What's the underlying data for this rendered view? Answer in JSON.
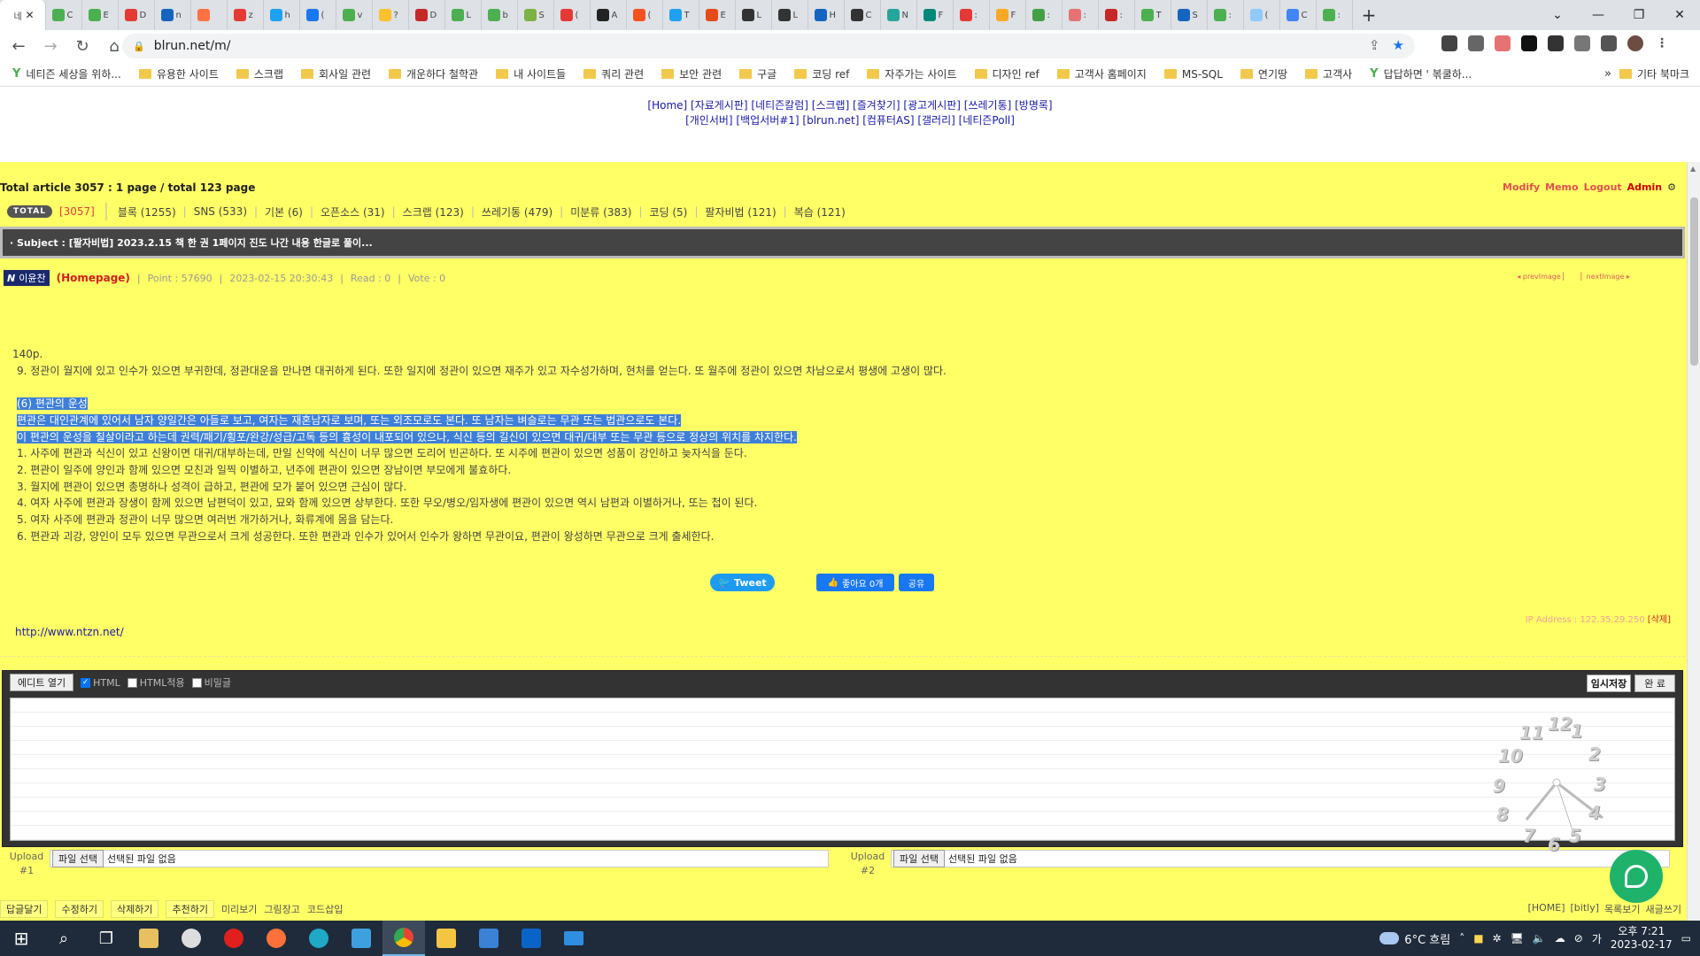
{
  "browser": {
    "tabs": [
      {
        "title": "네",
        "color": "#ffffff",
        "active": true
      },
      {
        "title": "C",
        "color": "#4caf50"
      },
      {
        "title": "E",
        "color": "#4caf50"
      },
      {
        "title": "D",
        "color": "#e53935"
      },
      {
        "title": "n",
        "color": "#1565c0"
      },
      {
        "title": "",
        "color": "#ff7043"
      },
      {
        "title": "z",
        "color": "#e53935"
      },
      {
        "title": "h",
        "color": "#1da1f2"
      },
      {
        "title": "(",
        "color": "#1877f2"
      },
      {
        "title": "v",
        "color": "#4caf50"
      },
      {
        "title": "?",
        "color": "#fbc02d"
      },
      {
        "title": "D",
        "color": "#c62828"
      },
      {
        "title": "L",
        "color": "#4caf50"
      },
      {
        "title": "b",
        "color": "#4caf50"
      },
      {
        "title": "S",
        "color": "#7cb342"
      },
      {
        "title": "(",
        "color": "#e53935"
      },
      {
        "title": "A",
        "color": "#222222"
      },
      {
        "title": "(",
        "color": "#f4511e"
      },
      {
        "title": "T",
        "color": "#1da1f2"
      },
      {
        "title": "E",
        "color": "#e64a19"
      },
      {
        "title": "L",
        "color": "#333333"
      },
      {
        "title": "L",
        "color": "#333333"
      },
      {
        "title": "H",
        "color": "#1565c0"
      },
      {
        "title": "C",
        "color": "#333333"
      },
      {
        "title": "N",
        "color": "#26a69a"
      },
      {
        "title": "F",
        "color": "#00897b"
      },
      {
        "title": ":",
        "color": "#e53935"
      },
      {
        "title": "F",
        "color": "#f9a825"
      },
      {
        "title": ":",
        "color": "#43a047"
      },
      {
        "title": ":",
        "color": "#e57373"
      },
      {
        "title": ":",
        "color": "#c62828"
      },
      {
        "title": "T",
        "color": "#4caf50"
      },
      {
        "title": "S",
        "color": "#1565c0"
      },
      {
        "title": ":",
        "color": "#4caf50"
      },
      {
        "title": "(",
        "color": "#90caf9"
      },
      {
        "title": "C",
        "color": "#4285f4"
      },
      {
        "title": ":",
        "color": "#4caf50"
      }
    ],
    "new_tab": "+",
    "url": "blrun.net/m/"
  },
  "bookmarks": [
    {
      "label": "네티즌 세상을 위하...",
      "type": "sprout"
    },
    {
      "label": "유용한 사이트",
      "type": "folder"
    },
    {
      "label": "스크랩",
      "type": "folder"
    },
    {
      "label": "회사일 관련",
      "type": "folder"
    },
    {
      "label": "개운하다 철학관",
      "type": "folder"
    },
    {
      "label": "내 사이트들",
      "type": "folder"
    },
    {
      "label": "쿼리 관련",
      "type": "folder"
    },
    {
      "label": "보안 관련",
      "type": "folder"
    },
    {
      "label": "구글",
      "type": "folder"
    },
    {
      "label": "코딩 ref",
      "type": "folder"
    },
    {
      "label": "자주가는 사이트",
      "type": "folder"
    },
    {
      "label": "디자인 ref",
      "type": "folder"
    },
    {
      "label": "고객사 홈페이지",
      "type": "folder"
    },
    {
      "label": "MS-SQL",
      "type": "folder"
    },
    {
      "label": "연기땅",
      "type": "folder"
    },
    {
      "label": "고객사",
      "type": "folder"
    },
    {
      "label": "답답하면 ' 볶쿨하...",
      "type": "sprout"
    }
  ],
  "bookmarks_more": "»",
  "bookmarks_other": "기타 북마크",
  "site_nav": {
    "row1": "[Home] [자료게시판] [네티즌칼럼] [스크랩] [즐겨찾기] [광고게시판] [쓰레기통] [방명록]",
    "row2": "[개인서버] [백업서버#1] [blrun.net] [컴퓨터AS] [갤러리] [네티즌Poll]"
  },
  "board": {
    "total_line": "Total article 3057 :   1 page / total 123 page",
    "admin_links": [
      "Modify",
      "Memo",
      "Logout"
    ],
    "admin_label": "Admin",
    "total_badge": "TOTAL",
    "total_count": "[3057]",
    "categories": [
      "블록 (1255)",
      "SNS (533)",
      "기본 (6)",
      "오픈소스 (31)",
      "스크랩 (123)",
      "쓰레기통 (479)",
      "미분류 (383)",
      "코딩 (5)",
      "팔자비법 (121)",
      "복습 (121)"
    ],
    "subject": "· Subject : [팔자비법] 2023.2.15 책 한 권 1페이지 진도 나간 내용 한글로 풀이...",
    "author_badge": "N",
    "author": "이윤찬",
    "homepage": "(Homepage)",
    "meta": [
      "Point : 57690",
      "2023-02-15 20:30:43",
      "Read : 0",
      "Vote : 0"
    ],
    "prev": "◂ prevImage ▏",
    "next": "▏nextImage ▸"
  },
  "article": {
    "lines": [
      {
        "text": "140p.",
        "hl": false,
        "ind": false
      },
      {
        "text": "9. 정관이 월지에 있고 인수가 있으면 부귀한데, 정관대운을 만나면 대귀하게 된다. 또한 일지에 정관이 있으면 재주가 있고 자수성가하며, 현처를 얻는다. 또 월주에 정관이 있으면 차남으로서 평생에 고생이 많다.",
        "hl": false,
        "ind": true
      },
      {
        "text": "",
        "hl": false,
        "ind": false
      },
      {
        "text": "(6) 편관의 운성",
        "hl": true,
        "ind": true
      },
      {
        "text": "편관은 대인관계에 있어서 남자 양일간은 아들로 보고, 여자는 재혼남자로 보며, 또는 외조모로도 본다. 또 남자는 벼슬로는 무관 또는 법관으로도 본다.",
        "hl": true,
        "ind": true
      },
      {
        "text": "이 편관의 운성을 칠살이라고 하는데 권력/패기/횡포/완강/성급/고독 등의 흉성이 내포되어 있으나, 식신 등의 길신이 있으면 대귀/대부 또는 무관 등으로 정상의 위치를 차지한다.",
        "hl": true,
        "ind": true
      },
      {
        "text": "1. 사주에 편관과 식신이 있고 신왕이면 대귀/대부하는데, 만일 신약에 식신이 너무 많으면 도리어 빈곤하다. 또 시주에 편관이 있으면 성품이 강인하고 늦자식을 둔다.",
        "hl": false,
        "ind": true
      },
      {
        "text": "2. 편관이 일주에 양인과 함께 있으면 모친과 일찍 이별하고, 년주에 편관이 있으면 장남이면 부모에게 불효하다.",
        "hl": false,
        "ind": true
      },
      {
        "text": "3. 월지에 편관이 있으면 총명하나 성격이 급하고, 편관에 모가 붙어 있으면 근심이 많다.",
        "hl": false,
        "ind": true
      },
      {
        "text": "4. 여자 사주에 편관과 장생이 함께 있으면 남편덕이 있고, 묘와 함께 있으면 상부한다. 또한 무오/병오/임자생에 편관이 있으면 역시 남편과 이별하거나, 또는 첩이 된다.",
        "hl": false,
        "ind": true
      },
      {
        "text": "5. 여자 사주에 편관과 정관이 너무 많으면 여러번 개가하거나, 화류계에 몸을 담는다.",
        "hl": false,
        "ind": true
      },
      {
        "text": "6. 편관과 괴강, 양인이 모두 있으면 무관으로서 크게 성공한다. 또한 편관과 인수가 있어서 인수가 왕하면 무관이요, 편관이 왕성하면 무관으로 크게 출세한다.",
        "hl": false,
        "ind": true
      }
    ],
    "tweet": "Tweet",
    "fb_like": "좋아요 0개",
    "fb_share": "공유",
    "link": "http://www.ntzn.net/",
    "ip_label": "IP Address : 122.35.29.250",
    "ip_delete": "[삭제]"
  },
  "editor": {
    "open_button": "에디트 열기",
    "checks": [
      {
        "label": "HTML",
        "checked": true
      },
      {
        "label": "HTML적용",
        "checked": false
      },
      {
        "label": "비밀글",
        "checked": false
      }
    ],
    "temp_save": "임시저장",
    "done": "완 료"
  },
  "clock_numbers": [
    "12",
    "1",
    "2",
    "3",
    "4",
    "5",
    "6",
    "7",
    "8",
    "9",
    "10",
    "11"
  ],
  "upload": [
    {
      "label": "Upload",
      "num": "#1",
      "button": "파일 선택",
      "status": "선택된 파일 없음"
    },
    {
      "label": "Upload",
      "num": "#2",
      "button": "파일 선택",
      "status": "선택된 파일 없음"
    }
  ],
  "bottom_buttons": [
    "답글달기",
    "수정하기",
    "삭제하기",
    "추천하기"
  ],
  "bottom_links": [
    "미리보기",
    "그림장고",
    "코드삽입"
  ],
  "bottom_right": [
    "[HOME]",
    "[bitly]",
    "목록보기",
    "새글쓰기"
  ],
  "taskbar": {
    "weather": "6°C 흐림",
    "time": "오후 7:21",
    "date": "2023-02-17"
  }
}
